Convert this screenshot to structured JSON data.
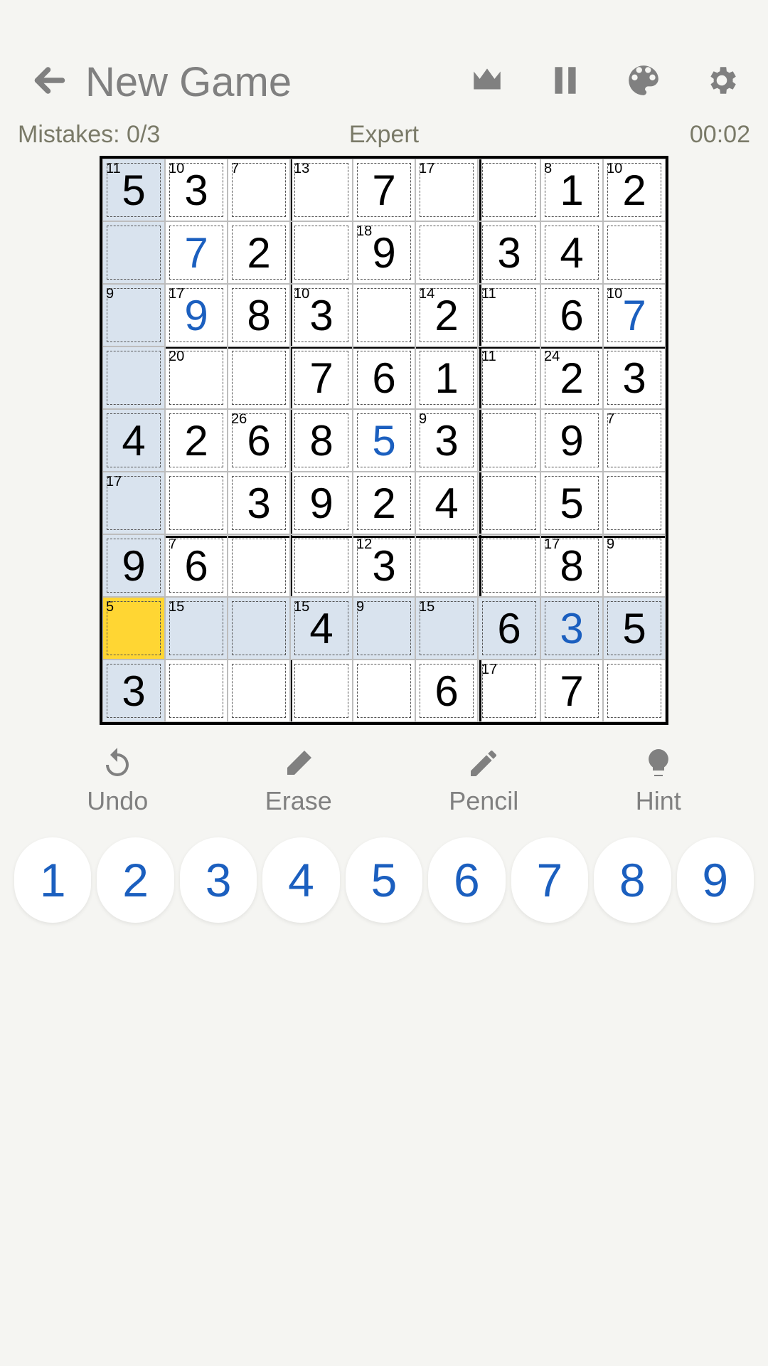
{
  "header": {
    "title": "New Game"
  },
  "status": {
    "mistakes_label": "Mistakes: 0/3",
    "difficulty": "Expert",
    "timer": "00:02"
  },
  "actions": {
    "undo": "Undo",
    "erase": "Erase",
    "pencil": "Pencil",
    "hint": "Hint"
  },
  "numpad": [
    "1",
    "2",
    "3",
    "4",
    "5",
    "6",
    "7",
    "8",
    "9"
  ],
  "board": {
    "size": 9,
    "selected": [
      7,
      0
    ],
    "highlight_row": 7,
    "highlight_col": 0,
    "cells": [
      [
        {
          "v": "5",
          "cage": "11"
        },
        {
          "v": "3",
          "cage": "10"
        },
        {
          "v": "",
          "cage": "7"
        },
        {
          "v": "",
          "cage": "13"
        },
        {
          "v": "7"
        },
        {
          "v": "",
          "cage": "17"
        },
        {
          "v": ""
        },
        {
          "v": "1",
          "cage": "8"
        },
        {
          "v": "2",
          "cage": "10"
        }
      ],
      [
        {
          "v": ""
        },
        {
          "v": "7",
          "u": true
        },
        {
          "v": "2"
        },
        {
          "v": ""
        },
        {
          "v": "9",
          "cage": "18"
        },
        {
          "v": ""
        },
        {
          "v": "3"
        },
        {
          "v": "4"
        },
        {
          "v": ""
        }
      ],
      [
        {
          "v": "",
          "cage": "9"
        },
        {
          "v": "9",
          "u": true,
          "cage": "17"
        },
        {
          "v": "8"
        },
        {
          "v": "3",
          "cage": "10"
        },
        {
          "v": ""
        },
        {
          "v": "2",
          "cage": "14"
        },
        {
          "v": "",
          "cage": "11"
        },
        {
          "v": "6"
        },
        {
          "v": "7",
          "u": true,
          "cage": "10"
        }
      ],
      [
        {
          "v": ""
        },
        {
          "v": "",
          "cage": "20"
        },
        {
          "v": ""
        },
        {
          "v": "7"
        },
        {
          "v": "6"
        },
        {
          "v": "1"
        },
        {
          "v": "",
          "cage": "11"
        },
        {
          "v": "2",
          "cage": "24"
        },
        {
          "v": "3"
        }
      ],
      [
        {
          "v": "4"
        },
        {
          "v": "2"
        },
        {
          "v": "6",
          "cage": "26"
        },
        {
          "v": "8"
        },
        {
          "v": "5",
          "u": true
        },
        {
          "v": "3",
          "cage": "9"
        },
        {
          "v": ""
        },
        {
          "v": "9"
        },
        {
          "v": "",
          "cage": "7"
        }
      ],
      [
        {
          "v": "",
          "cage": "17"
        },
        {
          "v": ""
        },
        {
          "v": "3"
        },
        {
          "v": "9"
        },
        {
          "v": "2"
        },
        {
          "v": "4"
        },
        {
          "v": ""
        },
        {
          "v": "5"
        },
        {
          "v": ""
        }
      ],
      [
        {
          "v": "9"
        },
        {
          "v": "6",
          "cage": "7"
        },
        {
          "v": ""
        },
        {
          "v": ""
        },
        {
          "v": "3",
          "cage": "12"
        },
        {
          "v": ""
        },
        {
          "v": ""
        },
        {
          "v": "8",
          "cage": "17"
        },
        {
          "v": "",
          "cage": "9"
        }
      ],
      [
        {
          "v": "",
          "cage": "5"
        },
        {
          "v": "",
          "cage": "15"
        },
        {
          "v": ""
        },
        {
          "v": "4",
          "cage": "15"
        },
        {
          "v": "",
          "cage": "9"
        },
        {
          "v": "",
          "cage": "15"
        },
        {
          "v": "6"
        },
        {
          "v": "3",
          "u": true
        },
        {
          "v": "5"
        }
      ],
      [
        {
          "v": "3"
        },
        {
          "v": ""
        },
        {
          "v": ""
        },
        {
          "v": ""
        },
        {
          "v": ""
        },
        {
          "v": "6"
        },
        {
          "v": "",
          "cage": "17"
        },
        {
          "v": "7"
        },
        {
          "v": ""
        }
      ]
    ]
  }
}
